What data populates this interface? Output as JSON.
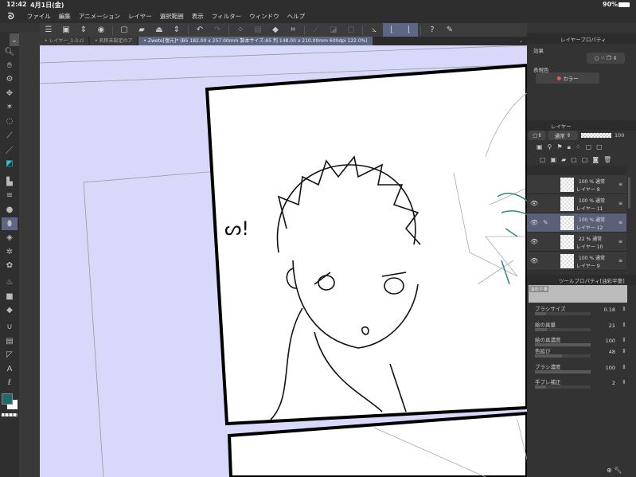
{
  "status": {
    "time": "12:42",
    "date": "4月1日(金)",
    "battery": "90%"
  },
  "menu": [
    "ファイル",
    "編集",
    "アニメーション",
    "レイヤー",
    "選択範囲",
    "表示",
    "フィルター",
    "ウィンドウ",
    "ヘルプ"
  ],
  "tabs": [
    "レイヤー_1-3.cl",
    "名称未設定のア",
    "Zwete[復元]* (B5 182.00 x 257.00mm 製本サイズ:A5 判 148.00 x 210.00mm 600dpi 122.0%)"
  ],
  "layer_property": {
    "title": "レイヤープロパティ",
    "effect_label": "効果",
    "display_color_label": "表現色",
    "display_color_value": "カラー"
  },
  "layers_panel": {
    "title": "レイヤー",
    "blend_mode": "通常",
    "opacity": "100",
    "layers": [
      {
        "name": "レイヤー 8",
        "opacity": "100 %",
        "mode": "通常",
        "visible": false,
        "selected": false
      },
      {
        "name": "レイヤー 11",
        "opacity": "100 %",
        "mode": "通常",
        "visible": true,
        "selected": false
      },
      {
        "name": "レイヤー 12",
        "opacity": "100 %",
        "mode": "通常",
        "visible": true,
        "selected": true
      },
      {
        "name": "レイヤー 10",
        "opacity": "22 %",
        "mode": "通常",
        "visible": true,
        "selected": false
      },
      {
        "name": "レイヤー 9",
        "opacity": "100 %",
        "mode": "通常",
        "visible": true,
        "selected": false
      }
    ]
  },
  "tool_property": {
    "title": "ツールプロパティ[油彩平筆]",
    "preset": "油彩平筆",
    "props": [
      {
        "name": "ブラシサイズ",
        "value": "0.18",
        "level": 0.2
      },
      {
        "name": "絵の具量",
        "value": "21",
        "level": 0.21
      },
      {
        "name": "絵の具濃度",
        "value": "100",
        "level": 1
      },
      {
        "name": "色延び",
        "value": "48",
        "level": 0.48
      },
      {
        "name": "ブラシ濃度",
        "value": "100",
        "level": 1
      },
      {
        "name": "手ブレ補正",
        "value": "2",
        "level": 0.2
      }
    ]
  },
  "colors": {
    "accent": "#5c6784",
    "main_color": "#1f6b6b",
    "sub_color": "#ffffff",
    "canvas_bg": "#d8d8fa"
  },
  "canvas_text": "ᔕ!"
}
